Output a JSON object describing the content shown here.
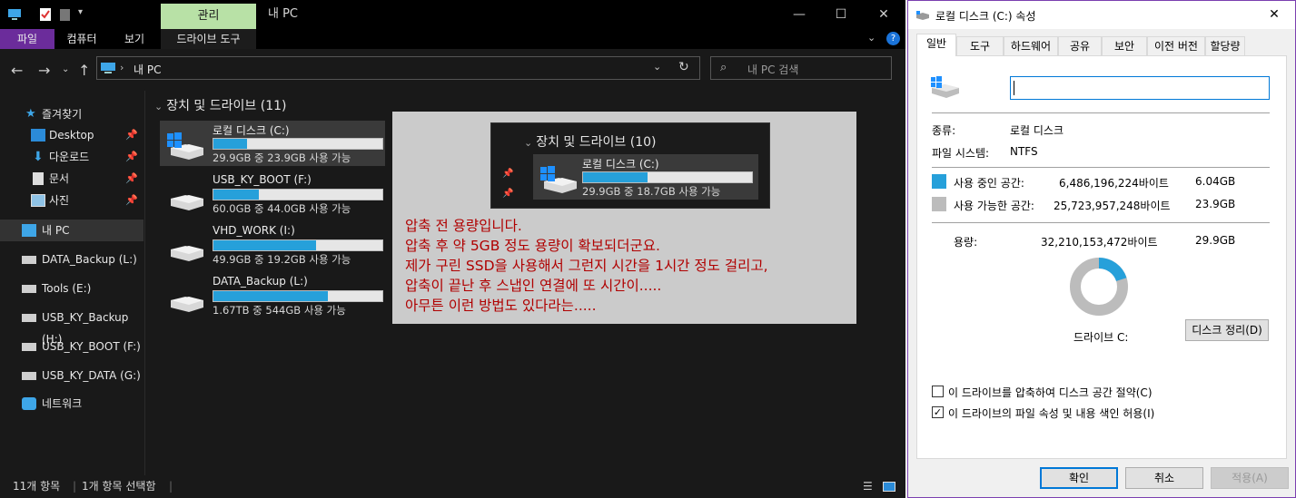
{
  "explorer": {
    "ribbon_manage_tab": "관리",
    "window_title": "내 PC",
    "ribbon_tabs": [
      "파일",
      "컴퓨터",
      "보기",
      "드라이브 도구"
    ],
    "address": "내 PC",
    "search_placeholder": "내 PC 검색",
    "group_header": "장치 및 드라이브 (11)",
    "nav": {
      "quick_access": "즐겨찾기",
      "desktop": "Desktop",
      "downloads": "다운로드",
      "documents": "문서",
      "pictures": "사진",
      "this_pc": "내 PC",
      "data_backup": "DATA_Backup (L:)",
      "tools": "Tools (E:)",
      "usb_backup": "USB_KY_Backup (H:)",
      "usb_boot": "USB_KY_BOOT (F:)",
      "usb_data": "USB_KY_DATA (G:)",
      "network": "네트워크"
    },
    "drives": [
      {
        "name": "로컬 디스크 (C:)",
        "space": "29.9GB 중 23.9GB 사용 가능",
        "used_fraction": 0.2,
        "windows": true
      },
      {
        "name": "USB_KY_BOOT (F:)",
        "space": "60.0GB 중 44.0GB 사용 가능",
        "used_fraction": 0.27,
        "windows": false
      },
      {
        "name": "VHD_WORK (I:)",
        "space": "49.9GB 중 19.2GB 사용 가능",
        "used_fraction": 0.61,
        "windows": false
      },
      {
        "name": "DATA_Backup (L:)",
        "space": "1.67TB 중 544GB 사용 가능",
        "used_fraction": 0.68,
        "windows": false
      }
    ],
    "status": {
      "items": "11개 항목",
      "selected": "1개 항목 선택함"
    }
  },
  "overlay": {
    "lines": [
      "압축 전 용량입니다.",
      "압축 후 약 5GB 정도 용량이 확보되더군요.",
      "제가 구린 SSD을 사용해서 그런지 시간을 1시간 정도 걸리고,",
      "압축이 끝난 후 스냅인 연결에 또 시간이.....",
      "아무튼 이런 방법도 있다라는....."
    ],
    "inset_header": "장치 및 드라이브 (10)",
    "inset_drive_name": "로컬 디스크 (C:)",
    "inset_drive_space": "29.9GB 중 18.7GB 사용 가능",
    "inset_used_fraction": 0.38
  },
  "dialog": {
    "title": "로컬 디스크 (C:) 속성",
    "tabs": [
      "일반",
      "도구",
      "하드웨어",
      "공유",
      "보안",
      "이전 버전",
      "할당량"
    ],
    "type_label": "종류:",
    "type_value": "로컬 디스크",
    "fs_label": "파일 시스템:",
    "fs_value": "NTFS",
    "used_label": "사용 중인 공간:",
    "used_bytes": "6,486,196,224바이트",
    "used_gb": "6.04GB",
    "free_label": "사용 가능한 공간:",
    "free_bytes": "25,723,957,248바이트",
    "free_gb": "23.9GB",
    "capacity_label": "용량:",
    "capacity_bytes": "32,210,153,472바이트",
    "capacity_gb": "29.9GB",
    "used_fraction": 0.2,
    "used_color": "#26a0da",
    "free_color": "#bcbcbc",
    "drive_label": "드라이브 C:",
    "cleanup_button": "디스크 정리(D)",
    "compress_label": "이 드라이브를 압축하여 디스크 공간 절약(C)",
    "index_label": "이 드라이브의 파일 속성 및 내용 색인 허용(I)",
    "ok": "확인",
    "cancel": "취소",
    "apply": "적용(A)"
  }
}
